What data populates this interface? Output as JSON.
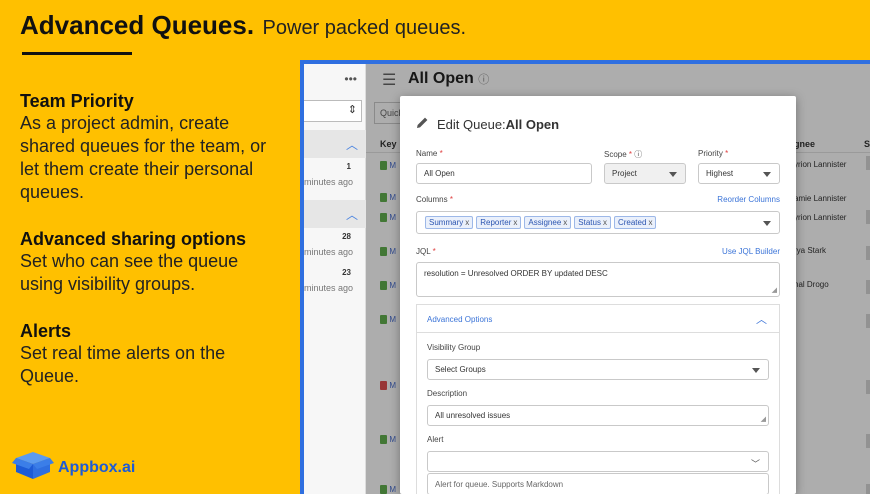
{
  "headline": {
    "bold": "Advanced Queues.",
    "light": "Power packed queues."
  },
  "features": [
    {
      "title": "Team Priority",
      "body": "As a project admin, create shared queues for the team, or let them create their personal queues."
    },
    {
      "title": "Advanced sharing options",
      "body": "Set who can see the queue using visibility groups."
    },
    {
      "title": "Alerts",
      "body": "Set real time alerts on the Queue."
    }
  ],
  "brand": {
    "name": "Appbox.ai",
    "icon": "box-logo-icon"
  },
  "app": {
    "title": "All Open",
    "quick_search": "Quick",
    "key_header": "Key",
    "assignee_header": "gnee",
    "last_header": "S",
    "groups": [
      {
        "count": "1",
        "ago": "minutes ago"
      },
      {
        "count": "28",
        "ago": "minutes ago"
      },
      {
        "count": "23",
        "ago": "minutes ago"
      }
    ],
    "issue_key_letter": "M",
    "assignees": [
      "yrion Lannister",
      "amie Lannister",
      "yrion Lannister",
      "rya Stark",
      "hal Drogo"
    ]
  },
  "modal": {
    "title_prefix": "Edit Queue:",
    "title_name": "All Open",
    "name_label": "Name",
    "name_value": "All Open",
    "scope_label": "Scope",
    "scope_value": "Project",
    "priority_label": "Priority",
    "priority_value": "Highest",
    "columns_label": "Columns",
    "reorder_link": "Reorder Columns",
    "columns": [
      "Summary",
      "Reporter",
      "Assignee",
      "Status",
      "Created"
    ],
    "chip_remove": "x",
    "jql_label": "JQL",
    "jql_link": "Use JQL Builder",
    "jql_value": "resolution = Unresolved ORDER BY updated DESC",
    "advanced_label": "Advanced Options",
    "visibility_label": "Visibility Group",
    "visibility_placeholder": "Select Groups",
    "description_label": "Description",
    "description_value": "All unresolved issues",
    "alert_label": "Alert",
    "alert_placeholder": "Alert for queue. Supports Markdown",
    "required_mark": "*"
  },
  "colors": {
    "background": "#FFC000",
    "accent": "#2f6fe0",
    "link": "#3b74d8"
  }
}
